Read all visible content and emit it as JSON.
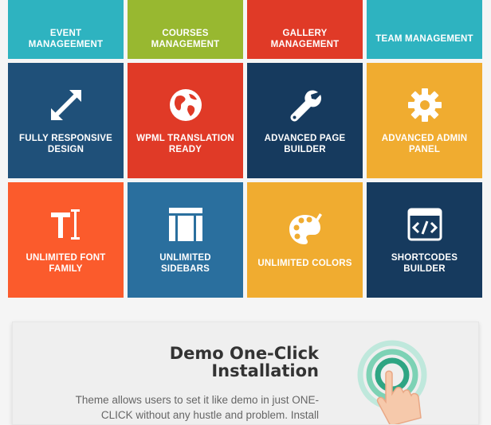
{
  "tiles": [
    {
      "label": "EVENT MANAGEEMENT",
      "color": "#2eb3c0",
      "icon": "none"
    },
    {
      "label": "COURSES MANAGEMENT",
      "color": "#98b830",
      "icon": "none"
    },
    {
      "label": "GALLERY MANAGEMENT",
      "color": "#e03a27",
      "icon": "none"
    },
    {
      "label": "TEAM MANAGEMENT",
      "color": "#2eb3c0",
      "icon": "none"
    },
    {
      "label": "FULLY RESPONSIVE DESIGN",
      "color": "#1f5079",
      "icon": "expand-arrows-icon"
    },
    {
      "label": "WPML TRANSLATION READY",
      "color": "#e03a27",
      "icon": "globe-icon"
    },
    {
      "label": "ADVANCED PAGE BUILDER",
      "color": "#163a5e",
      "icon": "wrench-icon"
    },
    {
      "label": "ADVANCED ADMIN PANEL",
      "color": "#f0ac30",
      "icon": "gear-icon"
    },
    {
      "label": "UNLIMITED FONT FAMILY",
      "color": "#fb5b2c",
      "icon": "text-cursor-icon"
    },
    {
      "label": "UNLIMITED SIDEBARS",
      "color": "#2a6f9e",
      "icon": "sidebar-layout-icon"
    },
    {
      "label": "UNLIMITED COLORS",
      "color": "#f0ac30",
      "icon": "palette-icon"
    },
    {
      "label": "SHORTCODES BUILDER",
      "color": "#163a5e",
      "icon": "code-window-icon"
    }
  ],
  "demo": {
    "title": "Demo One-Click Installation",
    "text": "Theme allows users to set it like demo in just ONE-CLICK without any hustle and problem. Install",
    "icon": "hand-tap-icon"
  }
}
